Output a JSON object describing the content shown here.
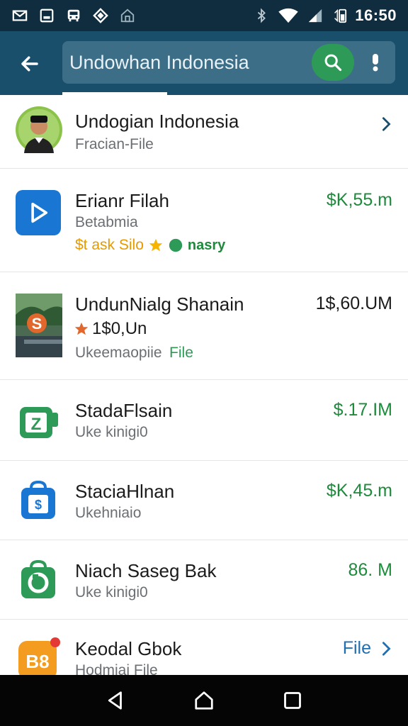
{
  "status_bar": {
    "time": "16:50",
    "icons": [
      "gmail-icon",
      "photo-icon",
      "bus-icon",
      "diamond-icon",
      "home-icon",
      "bluetooth-icon",
      "wifi-icon",
      "signal-icon",
      "battery-icon"
    ]
  },
  "header": {
    "search_text": "Undowhan Indonesia",
    "back_icon": "back-arrow-icon",
    "search_icon": "search-icon",
    "more_icon": "more-icon"
  },
  "list": [
    {
      "title": "Undogian Indonesia",
      "subtitle": "Fracian-File",
      "icon": "person-avatar",
      "trailing": "chevron-right-icon"
    },
    {
      "title": "Erianr Filah",
      "subtitle": "Betabmia",
      "tags": "$t ask Silo",
      "tags2": "nasry",
      "price": "$K,55.m",
      "icon": "play-icon"
    },
    {
      "title": "UndunNialg Shanain",
      "subtitle": "1$0,Un",
      "subtitle2": "Ukeemaopiie",
      "subtitle2_accent": "File",
      "price": "1$,60.UM",
      "icon": "photo-thumbnail"
    },
    {
      "title": "StadaFlsain",
      "subtitle": "Uke kinigi0",
      "price": "$.17.IM",
      "icon": "calendar-icon"
    },
    {
      "title": "StaciaHlnan",
      "subtitle": "Ukehniaio",
      "price": "$K,45.m",
      "icon": "bag-icon"
    },
    {
      "title": "Niach Saseg Bak",
      "subtitle": "Uke kinigi0",
      "price": "86. M",
      "icon": "bag-icon"
    },
    {
      "title": "Keodal Gbok",
      "subtitle": "Hodmiai File",
      "price": "File",
      "icon": "b8-icon",
      "trailing": "chevron-right-icon"
    }
  ],
  "colors": {
    "status_bar": "#0f2d3f",
    "app_bar": "#1a4f6b",
    "search_box": "#3d6e88",
    "search_button": "#2e9a57",
    "price_green": "#1e8a3c",
    "link_blue": "#1f6fb2"
  }
}
